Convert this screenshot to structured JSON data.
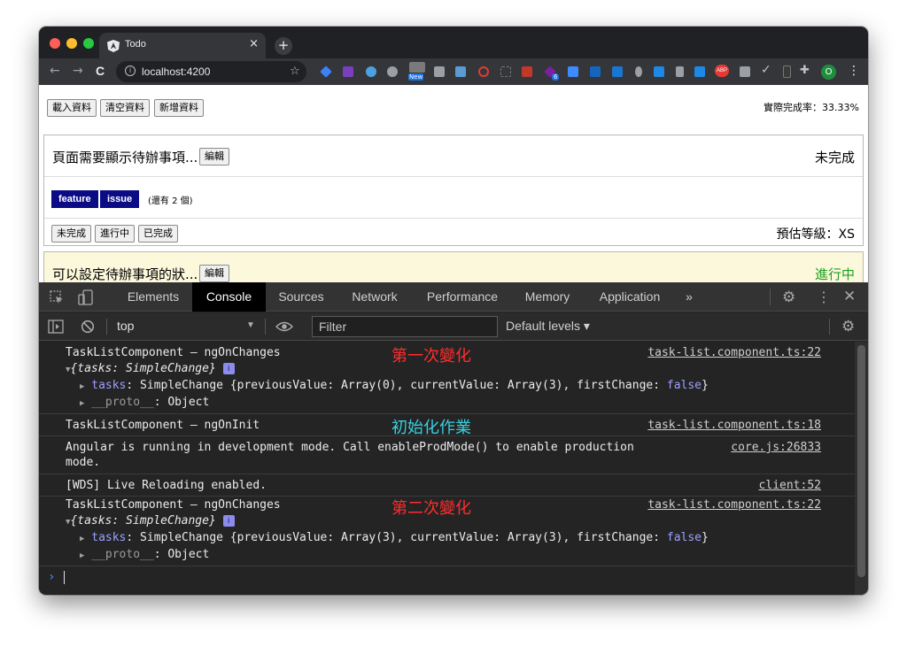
{
  "browser": {
    "tab_title": "Todo",
    "tab_close": "×",
    "new_tab": "+",
    "back": "←",
    "forward": "→",
    "reload": "C",
    "url": "localhost:4200",
    "bookmark": "☆",
    "profile_initial": "O",
    "menu": "⋮",
    "ext_new_label": "New",
    "ext_badge_count": "6",
    "ext_abp_label": "ABP"
  },
  "page": {
    "buttons": [
      "載入資料",
      "清空資料",
      "新增資料"
    ],
    "completion_rate": "實際完成率：33.33%",
    "card1": {
      "title": "頁面需要顯示待辦事項...",
      "edit": "編輯",
      "status": "未完成",
      "tags": [
        "feature",
        "issue"
      ],
      "more": "(還有 2 個)",
      "state_buttons": [
        "未完成",
        "進行中",
        "已完成"
      ],
      "level": "預估等級：XS"
    },
    "card2": {
      "title": "可以設定待辦事項的狀...",
      "edit": "編輯",
      "status": "進行中"
    }
  },
  "devtools": {
    "tabs": [
      "Elements",
      "Console",
      "Sources",
      "Network",
      "Performance",
      "Memory",
      "Application",
      "»"
    ],
    "active_tab": "Console",
    "context": "top",
    "filter_placeholder": "Filter",
    "levels": "Default levels ▾",
    "messages": {
      "m1": {
        "text": "TaskListComponent – ngOnChanges",
        "source": "task-list.component.ts:22",
        "obj": "{tasks: SimpleChange}",
        "tasks_key": "tasks",
        "tasks_sep": ":",
        "tasks_value_a": "SimpleChange {previousValue: Array(0), currentValue: Array(3), firstChange:",
        "tasks_value_bool": "false",
        "tasks_value_end": "}",
        "proto_key": "__proto__",
        "proto_value": ": Object"
      },
      "m2": {
        "text": "TaskListComponent – ngOnInit",
        "source": "task-list.component.ts:18"
      },
      "m3": {
        "line1": "Angular is running in development mode. Call enableProdMode() to enable production",
        "line2": "mode.",
        "source": "core.js:26833"
      },
      "m4": {
        "text": "[WDS] Live Reloading enabled.",
        "source": "client:52"
      },
      "m5": {
        "text": "TaskListComponent – ngOnChanges",
        "source": "task-list.component.ts:22",
        "obj": "{tasks: SimpleChange}",
        "tasks_key": "tasks",
        "tasks_sep": ":",
        "tasks_value_a": "SimpleChange {previousValue: Array(3), currentValue: Array(3), firstChange:",
        "tasks_value_bool": "false",
        "tasks_value_end": "}",
        "proto_key": "__proto__",
        "proto_value": ": Object"
      }
    },
    "prompt": "›"
  },
  "annotations": {
    "first_change": "第一次變化",
    "init": "初始化作業",
    "second_change": "第二次變化"
  },
  "colors": {
    "tag_bg": "#0b0b86",
    "in_progress": "#20a020",
    "annotation_red": "#ff2d2d",
    "annotation_cyan": "#38d0e0",
    "keyword_blue": "#9ca0ff"
  }
}
